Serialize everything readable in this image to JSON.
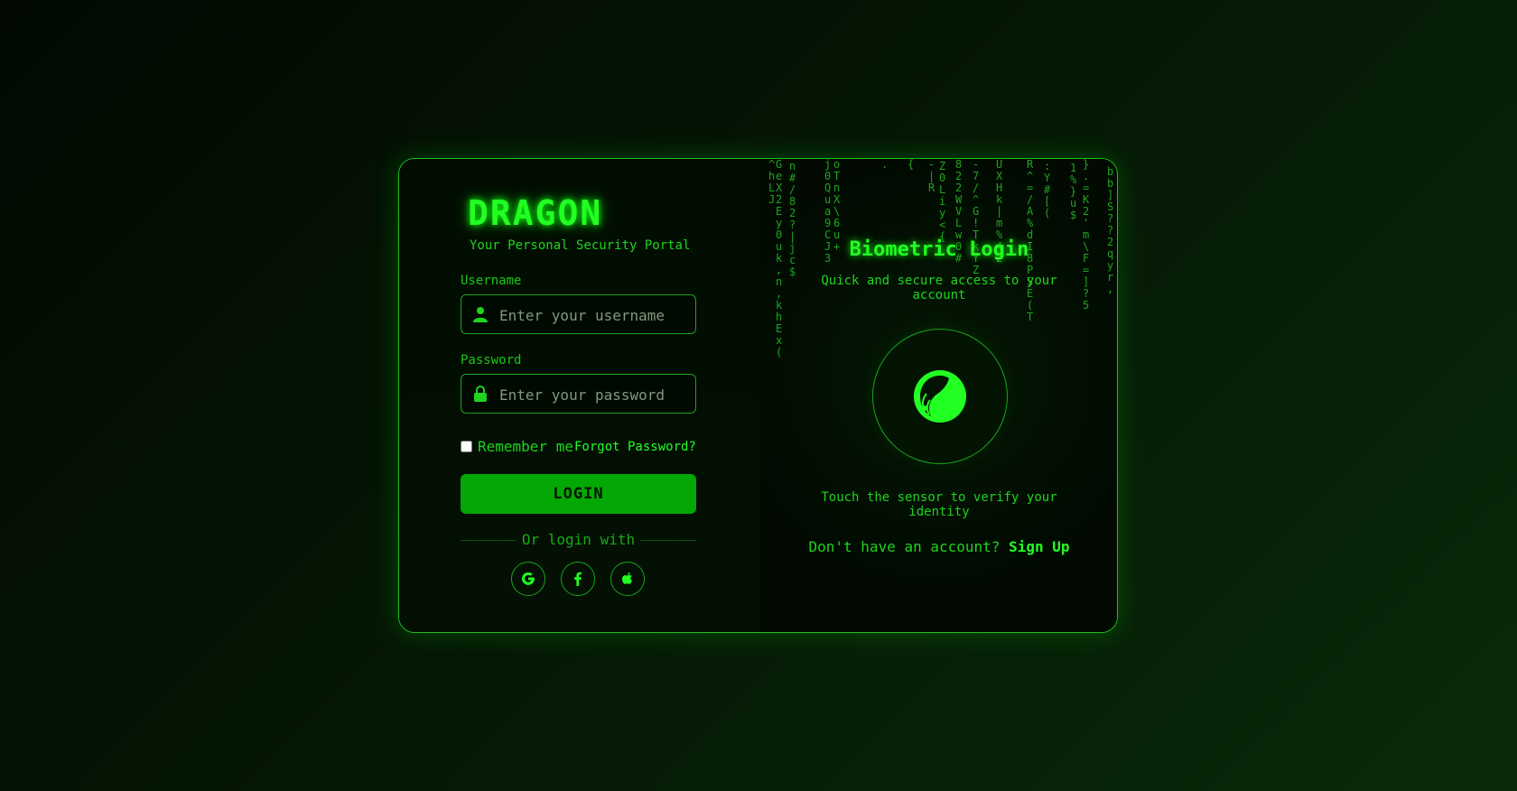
{
  "brand": {
    "name": "DRAGON",
    "tagline": "Your Personal Security Portal"
  },
  "form": {
    "username_label": "Username",
    "username_placeholder": "Enter your username",
    "password_label": "Password",
    "password_placeholder": "Enter your password",
    "remember_label": "Remember me",
    "forgot_label": "Forgot Password?",
    "login_label": "LOGIN",
    "divider_text": "Or login with"
  },
  "biometric": {
    "title": "Biometric Login",
    "subtitle": "Quick and secure access to your account",
    "touch_text": "Touch the sensor to verify your identity",
    "signup_prompt": "Don't have an account? ",
    "signup_link": "Sign Up"
  },
  "social": [
    "google-icon",
    "facebook-icon",
    "apple-icon"
  ],
  "colors": {
    "accent": "#22ff22",
    "button": "#04a804",
    "border": "#1aa51a",
    "background": "#020a02"
  },
  "matrix_columns": [
    "^\nh\nL\nJ",
    "G\ne\nX\n2\nE\ny\n0\nu\nk\n,\nn\n,\nk\nh\nE\nx\n(",
    "n\n#\n/\n8\n2\n?\n|\nj\nc\n$",
    "j\n0\nQ\nu\na\n9\nC\nJ\n3",
    "o\nT\nn\nX\n\\\n6\nu\n+",
    ".",
    "{",
    "-\n|\nR",
    "Z\n0\nL\ni\ny\n<\n{",
    "8\n2\n2\nW\nV\nL\nw\n0\n#",
    "-\n7\n/\n^\nG\n!\nT\nk\nY\nZ",
    "U\nX\nH\nk\n|\nm\n%\n4\n2",
    "R\n^\n=\n/\nA\n%\nd\nI\n8\nP\nS\nE\n(\nT",
    ":\nY\n#\n[\n(",
    "1\n%\n}\nu\n$",
    "}\n.\n=\nK\n2\n'\nm\n\\\nF\n=\n]\n?\n5",
    "b\nb\n]\nS\n?\n?\n2\nq\ny\nr\n,"
  ]
}
